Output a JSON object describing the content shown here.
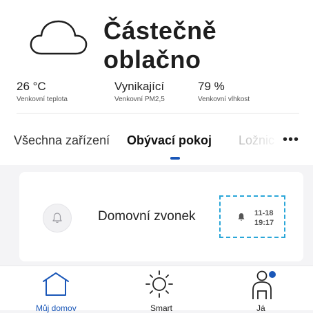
{
  "weather": {
    "condition": "Částečně oblačno",
    "icon": "cloud-icon",
    "stats": [
      {
        "value": "26 °C",
        "label": "Venkovní teplota"
      },
      {
        "value": "Vynikající",
        "label": "Venkovní PM2,5"
      },
      {
        "value": "79 %",
        "label": "Venkovní vlhkost"
      }
    ]
  },
  "tabs": {
    "items": [
      "Všechna zařízení",
      "Obývací pokoj",
      "Ložnice"
    ],
    "selected": "Obývací pokoj",
    "more_label": "•••"
  },
  "device_card": {
    "name": "Domovní zvonek",
    "icon": "bell-icon",
    "last_event": {
      "date": "11-18",
      "time": "19:17"
    }
  },
  "bottom_nav": {
    "items": [
      {
        "label": "Můj domov",
        "icon": "home-icon",
        "active": true
      },
      {
        "label": "Smart",
        "icon": "sun-icon",
        "active": false
      },
      {
        "label": "Já",
        "icon": "profile-icon",
        "active": false
      }
    ]
  },
  "colors": {
    "accent": "#1a57b8",
    "event_border": "#2aa6d8",
    "notification_dot": "#1a57b8",
    "background": "#f4f4f6"
  }
}
